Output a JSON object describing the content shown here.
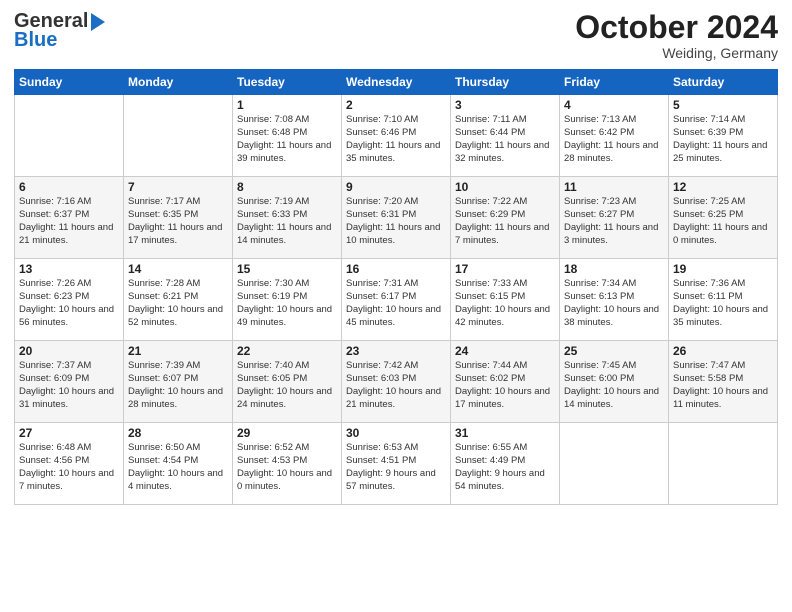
{
  "logo": {
    "line1": "General",
    "line2": "Blue"
  },
  "title": "October 2024",
  "location": "Weiding, Germany",
  "days_of_week": [
    "Sunday",
    "Monday",
    "Tuesday",
    "Wednesday",
    "Thursday",
    "Friday",
    "Saturday"
  ],
  "weeks": [
    [
      {
        "day": "",
        "info": ""
      },
      {
        "day": "",
        "info": ""
      },
      {
        "day": "1",
        "info": "Sunrise: 7:08 AM\nSunset: 6:48 PM\nDaylight: 11 hours and 39 minutes."
      },
      {
        "day": "2",
        "info": "Sunrise: 7:10 AM\nSunset: 6:46 PM\nDaylight: 11 hours and 35 minutes."
      },
      {
        "day": "3",
        "info": "Sunrise: 7:11 AM\nSunset: 6:44 PM\nDaylight: 11 hours and 32 minutes."
      },
      {
        "day": "4",
        "info": "Sunrise: 7:13 AM\nSunset: 6:42 PM\nDaylight: 11 hours and 28 minutes."
      },
      {
        "day": "5",
        "info": "Sunrise: 7:14 AM\nSunset: 6:39 PM\nDaylight: 11 hours and 25 minutes."
      }
    ],
    [
      {
        "day": "6",
        "info": "Sunrise: 7:16 AM\nSunset: 6:37 PM\nDaylight: 11 hours and 21 minutes."
      },
      {
        "day": "7",
        "info": "Sunrise: 7:17 AM\nSunset: 6:35 PM\nDaylight: 11 hours and 17 minutes."
      },
      {
        "day": "8",
        "info": "Sunrise: 7:19 AM\nSunset: 6:33 PM\nDaylight: 11 hours and 14 minutes."
      },
      {
        "day": "9",
        "info": "Sunrise: 7:20 AM\nSunset: 6:31 PM\nDaylight: 11 hours and 10 minutes."
      },
      {
        "day": "10",
        "info": "Sunrise: 7:22 AM\nSunset: 6:29 PM\nDaylight: 11 hours and 7 minutes."
      },
      {
        "day": "11",
        "info": "Sunrise: 7:23 AM\nSunset: 6:27 PM\nDaylight: 11 hours and 3 minutes."
      },
      {
        "day": "12",
        "info": "Sunrise: 7:25 AM\nSunset: 6:25 PM\nDaylight: 11 hours and 0 minutes."
      }
    ],
    [
      {
        "day": "13",
        "info": "Sunrise: 7:26 AM\nSunset: 6:23 PM\nDaylight: 10 hours and 56 minutes."
      },
      {
        "day": "14",
        "info": "Sunrise: 7:28 AM\nSunset: 6:21 PM\nDaylight: 10 hours and 52 minutes."
      },
      {
        "day": "15",
        "info": "Sunrise: 7:30 AM\nSunset: 6:19 PM\nDaylight: 10 hours and 49 minutes."
      },
      {
        "day": "16",
        "info": "Sunrise: 7:31 AM\nSunset: 6:17 PM\nDaylight: 10 hours and 45 minutes."
      },
      {
        "day": "17",
        "info": "Sunrise: 7:33 AM\nSunset: 6:15 PM\nDaylight: 10 hours and 42 minutes."
      },
      {
        "day": "18",
        "info": "Sunrise: 7:34 AM\nSunset: 6:13 PM\nDaylight: 10 hours and 38 minutes."
      },
      {
        "day": "19",
        "info": "Sunrise: 7:36 AM\nSunset: 6:11 PM\nDaylight: 10 hours and 35 minutes."
      }
    ],
    [
      {
        "day": "20",
        "info": "Sunrise: 7:37 AM\nSunset: 6:09 PM\nDaylight: 10 hours and 31 minutes."
      },
      {
        "day": "21",
        "info": "Sunrise: 7:39 AM\nSunset: 6:07 PM\nDaylight: 10 hours and 28 minutes."
      },
      {
        "day": "22",
        "info": "Sunrise: 7:40 AM\nSunset: 6:05 PM\nDaylight: 10 hours and 24 minutes."
      },
      {
        "day": "23",
        "info": "Sunrise: 7:42 AM\nSunset: 6:03 PM\nDaylight: 10 hours and 21 minutes."
      },
      {
        "day": "24",
        "info": "Sunrise: 7:44 AM\nSunset: 6:02 PM\nDaylight: 10 hours and 17 minutes."
      },
      {
        "day": "25",
        "info": "Sunrise: 7:45 AM\nSunset: 6:00 PM\nDaylight: 10 hours and 14 minutes."
      },
      {
        "day": "26",
        "info": "Sunrise: 7:47 AM\nSunset: 5:58 PM\nDaylight: 10 hours and 11 minutes."
      }
    ],
    [
      {
        "day": "27",
        "info": "Sunrise: 6:48 AM\nSunset: 4:56 PM\nDaylight: 10 hours and 7 minutes."
      },
      {
        "day": "28",
        "info": "Sunrise: 6:50 AM\nSunset: 4:54 PM\nDaylight: 10 hours and 4 minutes."
      },
      {
        "day": "29",
        "info": "Sunrise: 6:52 AM\nSunset: 4:53 PM\nDaylight: 10 hours and 0 minutes."
      },
      {
        "day": "30",
        "info": "Sunrise: 6:53 AM\nSunset: 4:51 PM\nDaylight: 9 hours and 57 minutes."
      },
      {
        "day": "31",
        "info": "Sunrise: 6:55 AM\nSunset: 4:49 PM\nDaylight: 9 hours and 54 minutes."
      },
      {
        "day": "",
        "info": ""
      },
      {
        "day": "",
        "info": ""
      }
    ]
  ]
}
